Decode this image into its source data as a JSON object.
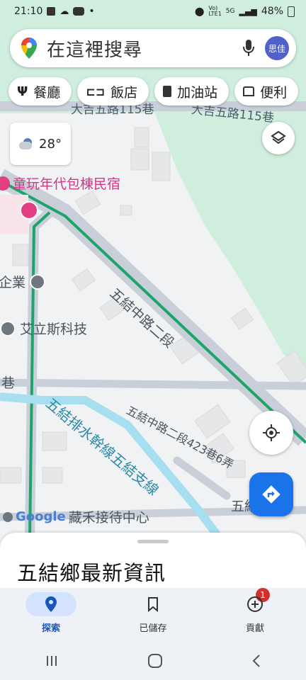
{
  "status": {
    "time": "21:10",
    "battery": "48%"
  },
  "search": {
    "placeholder": "在這裡搜尋",
    "avatar": "思佳"
  },
  "chips": [
    {
      "label": "餐廳",
      "icon": "fork-knife-icon"
    },
    {
      "label": "飯店",
      "icon": "bed-icon"
    },
    {
      "label": "加油站",
      "icon": "gas-station-icon"
    },
    {
      "label": "便利",
      "icon": "store-icon"
    }
  ],
  "weather": {
    "temp": "28°"
  },
  "map_labels": {
    "street_top": "大吉五路115巷",
    "street_top2": "大吉五路115巷",
    "hotel": "童玩年代包棟民宿",
    "company": "企業",
    "tech": "艾立斯科技",
    "alley": "巷",
    "road_main": "五結中路二段",
    "canal": "五結排水幹線五結支線",
    "lane": "五結中路二段423巷6弄",
    "road_wu": "五結",
    "reception": "藏禾接待中心",
    "google": "Google"
  },
  "sheet": {
    "title": "五結鄉最新資訊"
  },
  "nav": {
    "explore": "探索",
    "saved": "已儲存",
    "contribute": "貢獻",
    "saved_badge": "1"
  }
}
